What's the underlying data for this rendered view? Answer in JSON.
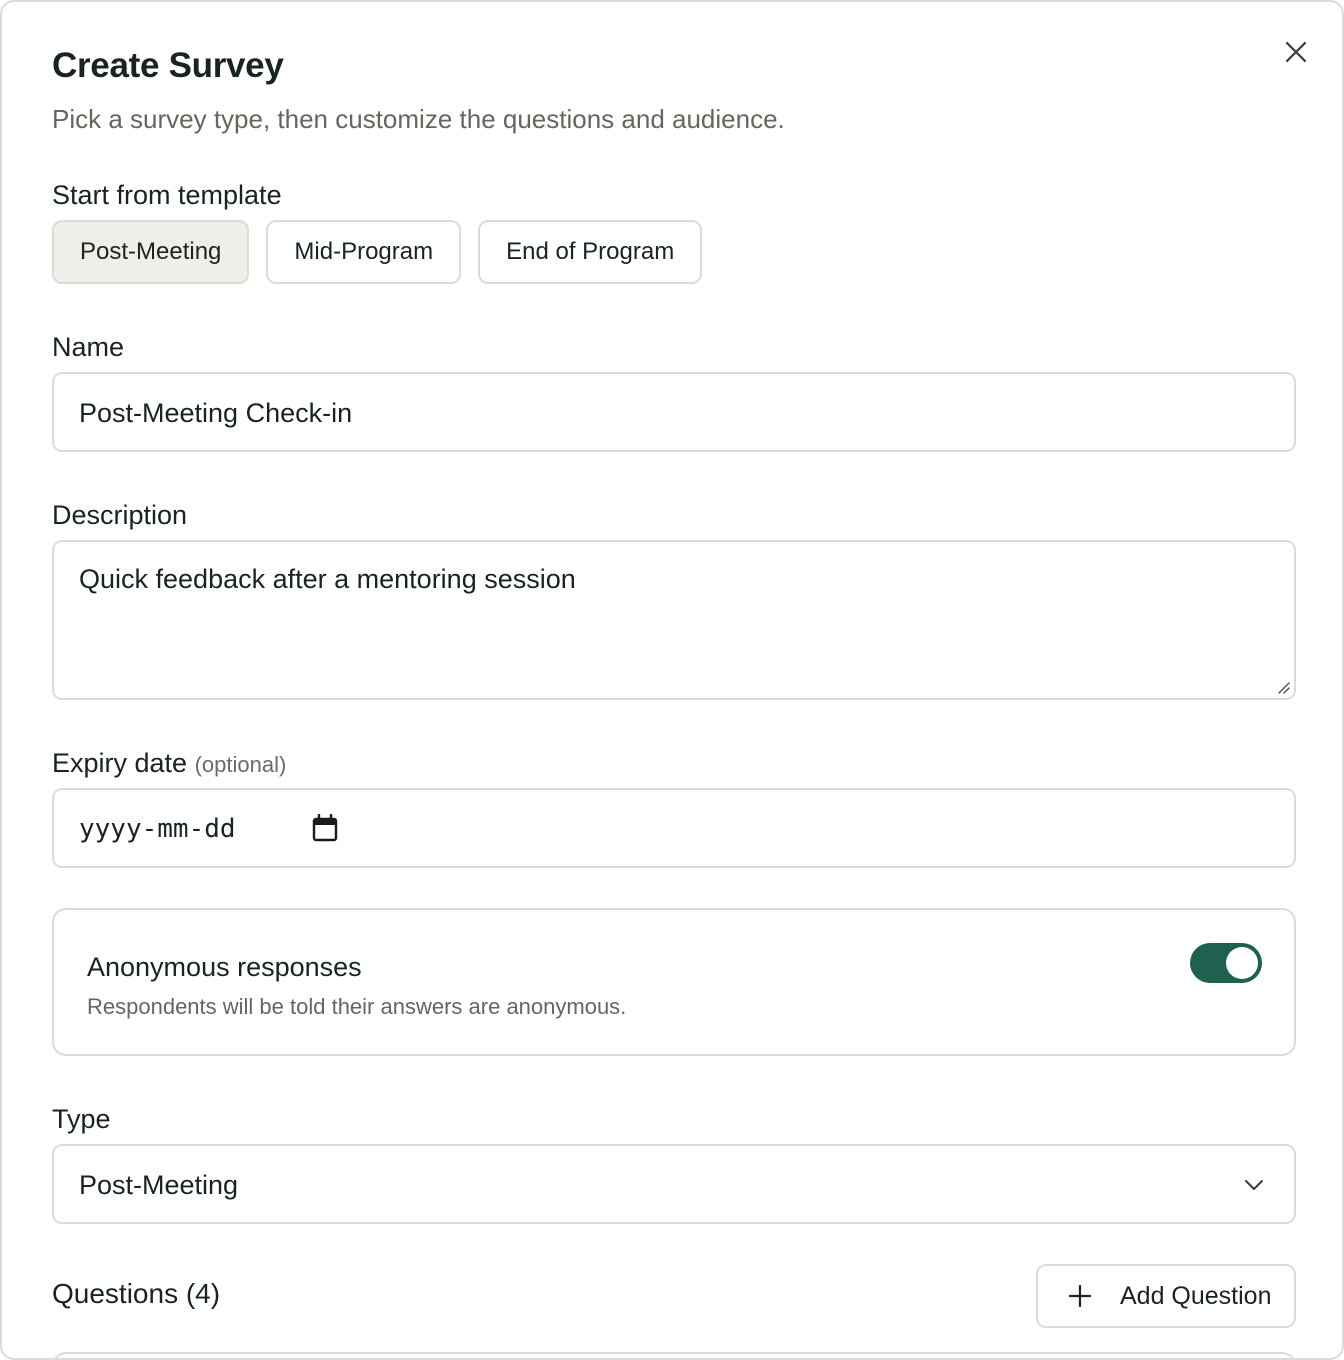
{
  "dialog": {
    "title": "Create Survey",
    "subtitle": "Pick a survey type, then customize the questions and audience.",
    "close_icon": "close-icon"
  },
  "templates": {
    "label": "Start from template",
    "options": [
      "Post-Meeting",
      "Mid-Program",
      "End of Program"
    ],
    "selected": "Post-Meeting"
  },
  "name": {
    "label": "Name",
    "value": "Post-Meeting Check-in"
  },
  "description": {
    "label": "Description",
    "value": "Quick feedback after a mentoring session"
  },
  "expiry": {
    "label": "Expiry date",
    "optional": "(optional)",
    "placeholder": "yyyy-mm-dd",
    "icon": "calendar-icon"
  },
  "anonymous": {
    "title": "Anonymous responses",
    "description": "Respondents will be told their answers are anonymous.",
    "enabled": true
  },
  "type": {
    "label": "Type",
    "value": "Post-Meeting",
    "icon": "chevron-down-icon"
  },
  "questions": {
    "title": "Questions (4)",
    "add_label": "Add Question",
    "add_icon": "plus-icon"
  },
  "colors": {
    "accent": "#1e6150",
    "border": "#dcdcd6",
    "selected_bg": "#efeee9",
    "text": "#17251e",
    "muted": "#66665f"
  }
}
